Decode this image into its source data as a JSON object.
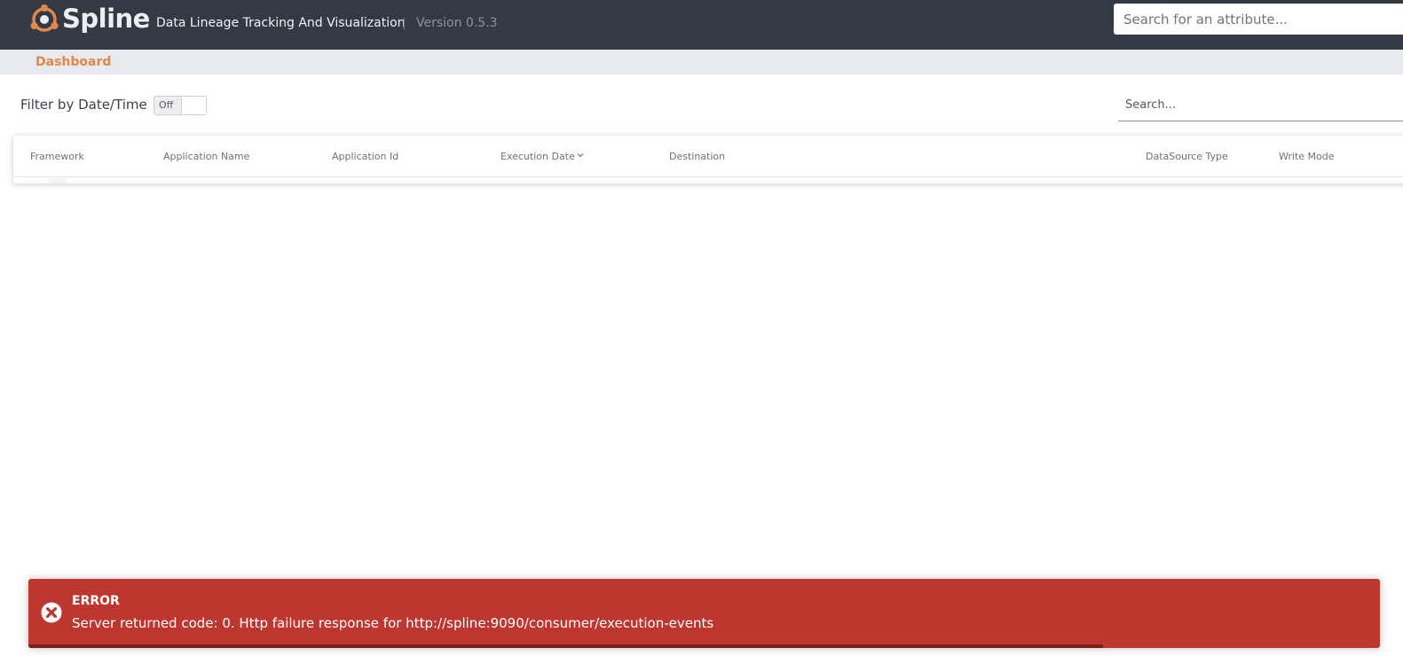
{
  "header": {
    "brand": "Spline",
    "subtitle": "Data Lineage Tracking And Visualization",
    "separator": "|",
    "version": "Version 0.5.3",
    "attribute_search_placeholder": "Search for an attribute..."
  },
  "breadcrumb": {
    "items": [
      "Dashboard"
    ]
  },
  "filter": {
    "label": "Filter by Date/Time",
    "toggle_state": "Off",
    "search_placeholder": "Search..."
  },
  "table": {
    "columns": [
      "Framework",
      "Application Name",
      "Application Id",
      "Execution Date",
      "Destination",
      "DataSource Type",
      "Write Mode"
    ],
    "sorted_column": "Execution Date",
    "sort_direction": "descending",
    "rows": []
  },
  "toast": {
    "title": "ERROR",
    "message": "Server returned code: 0. Http failure response for http://spline:9090/consumer/execution-events",
    "progress": 0.795
  },
  "colors": {
    "navbar": "#343a43",
    "accent": "#e2874a",
    "breadcrumb_bg": "#e7ebef",
    "error": "#bd362f"
  }
}
